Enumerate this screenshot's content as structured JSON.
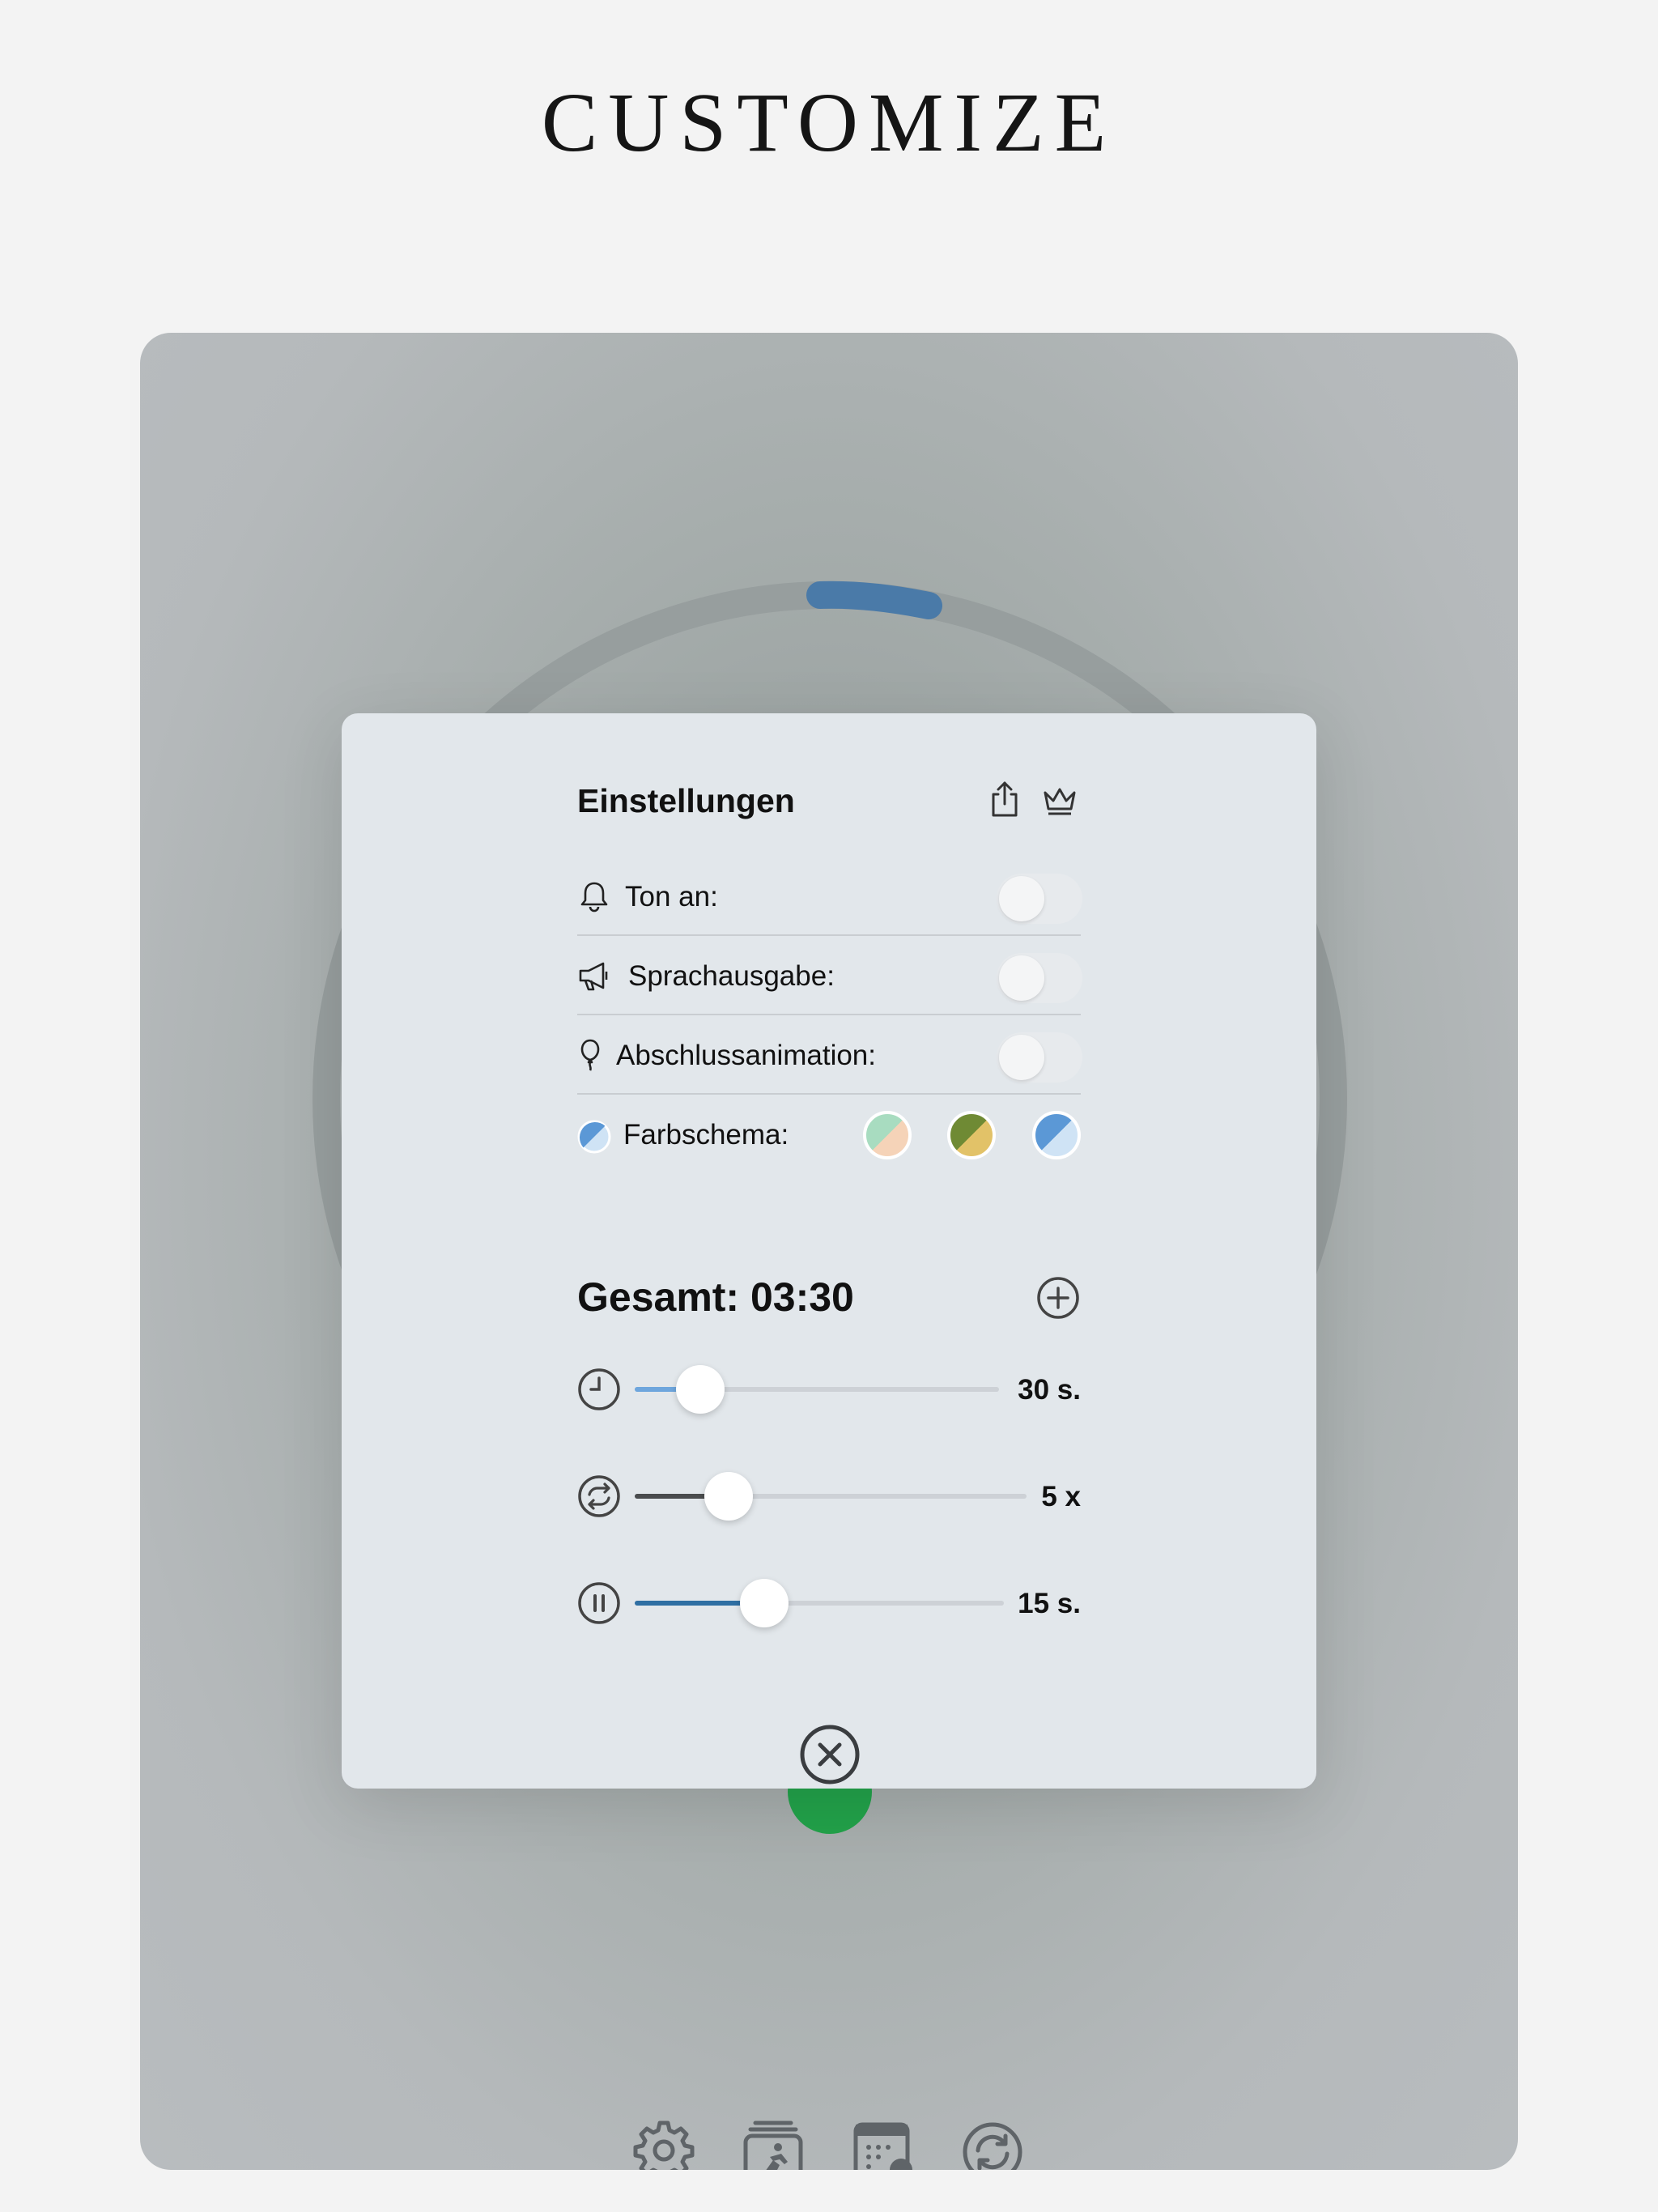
{
  "headline": "CUSTOMIZE",
  "settings": {
    "title": "Einstellungen",
    "rows": [
      {
        "label": "Ton an:",
        "icon": "bell-icon",
        "on": false
      },
      {
        "label": "Sprachausgabe:",
        "icon": "megaphone-icon",
        "on": false
      },
      {
        "label": "Abschlussanimation:",
        "icon": "balloon-icon",
        "on": false
      }
    ],
    "color_scheme": {
      "label": "Farbschema:",
      "options": [
        {
          "a": "#a8dcc0",
          "b": "#f5d3b8"
        },
        {
          "a": "#6f8a34",
          "b": "#e2c268"
        },
        {
          "a": "#5b98d6",
          "b": "#cfe3f5"
        }
      ],
      "selected": 2
    }
  },
  "timer": {
    "total_label": "Gesamt: 03:30",
    "sliders": [
      {
        "name": "work",
        "icon": "clock-icon",
        "value_label": "30 s.",
        "level": 0.18,
        "fill_color": "#6ea6dd"
      },
      {
        "name": "rounds",
        "icon": "repeat-icon",
        "value_label": "5 x",
        "level": 0.24,
        "fill_color": "#4a4c4e"
      },
      {
        "name": "rest",
        "icon": "pause-icon",
        "value_label": "15 s.",
        "level": 0.35,
        "fill_color": "#2f6fa3"
      }
    ]
  },
  "colors": {
    "accent": "#4a7aa8",
    "start": "#22a24a"
  },
  "bottom_bar": [
    "gear-icon",
    "workout-list-icon",
    "calendar-icon",
    "reset-icon"
  ]
}
